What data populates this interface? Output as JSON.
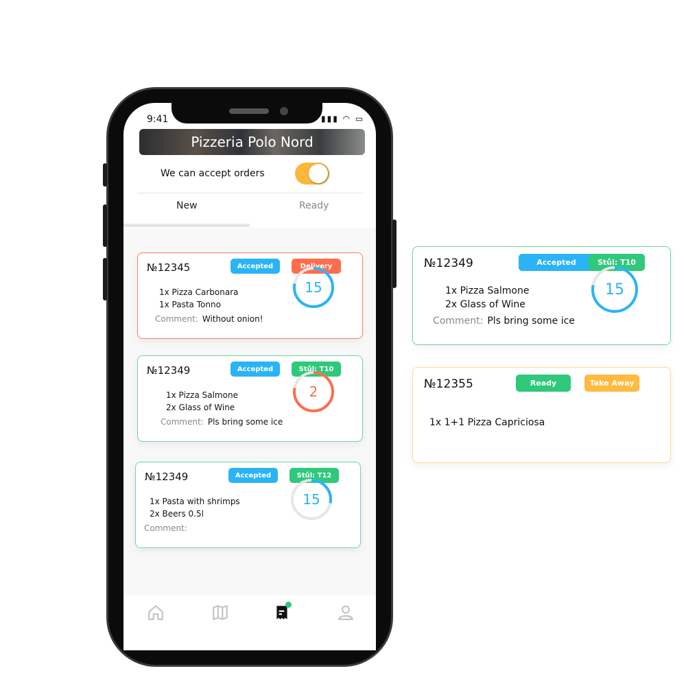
{
  "status_bar": {
    "time": "9:41",
    "icons": "▮▮▮ ◠ ▭"
  },
  "header": {
    "title": "Pizzeria Polo Nord"
  },
  "accept_toggle": {
    "label": "We can accept orders",
    "on": true,
    "color": "#fbb73c"
  },
  "tabs": [
    {
      "label": "New",
      "active": true
    },
    {
      "label": "Ready",
      "active": false
    }
  ],
  "colors": {
    "accepted": "#2ab4f5",
    "delivery": "#ff6d4d",
    "table": "#2ec97a",
    "ready": "#2ec97a",
    "take_away": "#ffba3f",
    "orange_border": "#ff7f5e",
    "green_border": "#6cd6a0",
    "yellow_border": "#ffd98c",
    "ring_blue": "#2ab4f5",
    "ring_orange": "#ff6d4d",
    "ring_track": "#e6e6e6"
  },
  "orders": [
    {
      "number": "№12345",
      "badges": [
        "Accepted",
        "Delivery"
      ],
      "items": [
        "1x Pizza  Carbonara",
        "1x Pasta Tonno"
      ],
      "comment_label": "Comment:",
      "comment": "Without onion!",
      "timer": "15",
      "progress": 0.78
    },
    {
      "number": "№12349",
      "badges": [
        "Accepted",
        "Stůl: T10"
      ],
      "items": [
        "1x Pizza  Salmone",
        "2x Glass of  Wine"
      ],
      "comment_label": "Comment:",
      "comment": "Pls bring some ice",
      "timer": "2",
      "progress": 0.78
    },
    {
      "number": "№12349",
      "badges": [
        "Accepted",
        "Stůl: T12"
      ],
      "items": [
        "1x Pasta   with shrimps",
        "2x Beers 0.5l"
      ],
      "comment_label": "Comment:",
      "comment": "",
      "timer": "15",
      "progress": 0.28
    }
  ],
  "floating_orders": [
    {
      "number": "№12349",
      "badges": [
        "Accepted",
        "Stůl: T10"
      ],
      "items": [
        "1x Pizza  Salmone",
        "2x Glass of  Wine"
      ],
      "comment_label": "Comment:",
      "comment": "Pls bring some ice",
      "timer": "15",
      "progress": 0.78
    },
    {
      "number": "№12355",
      "badges": [
        "Ready",
        "Take Away"
      ],
      "items": [
        "1x 1+1 Pizza Capriciosa"
      ]
    }
  ],
  "bottom_nav": [
    {
      "icon": "home-icon"
    },
    {
      "icon": "map-icon"
    },
    {
      "icon": "orders-icon",
      "active": true,
      "notification": true
    },
    {
      "icon": "profile-icon"
    }
  ]
}
